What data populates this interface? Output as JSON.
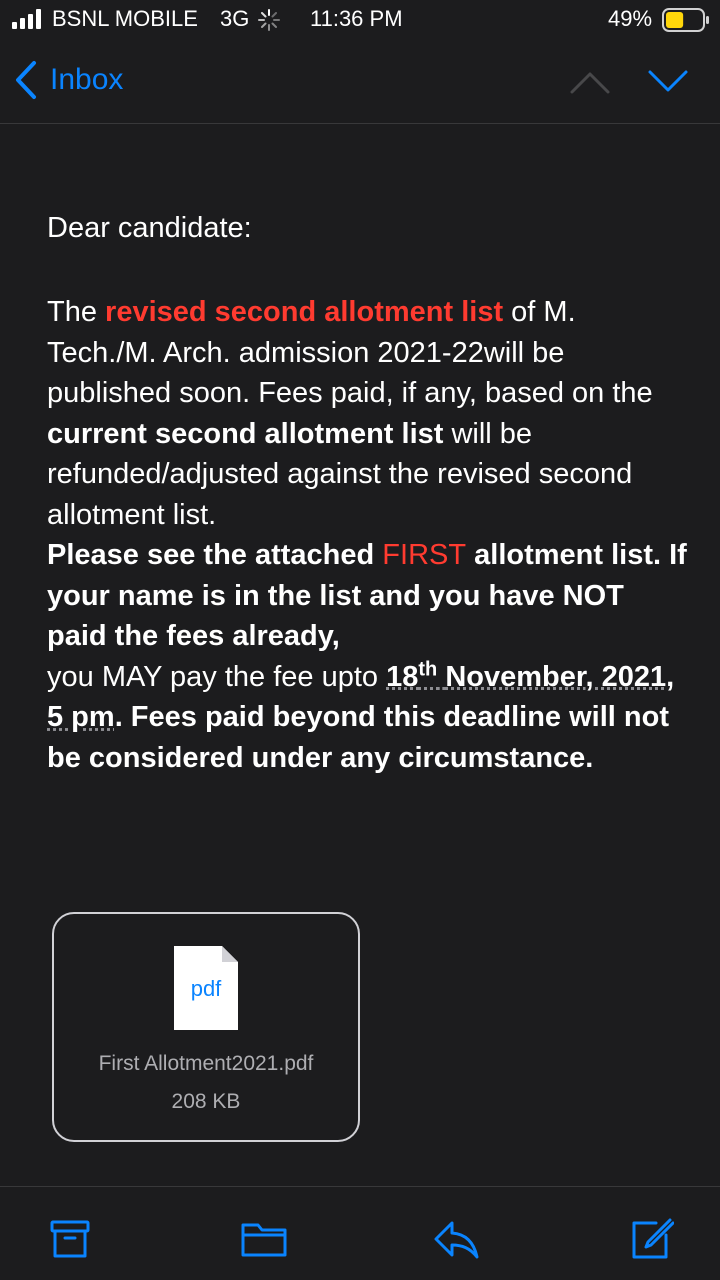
{
  "status_bar": {
    "carrier": "BSNL MOBILE",
    "network": "3G",
    "time": "11:36 PM",
    "battery_percent": "49%",
    "battery_level": 0.49,
    "signal_icon": "signal-bars-icon",
    "battery_color": "#ffd60a"
  },
  "nav": {
    "back_label": "Inbox",
    "back_icon": "chevron-left-icon",
    "prev_icon": "chevron-up-icon",
    "next_icon": "chevron-down-icon",
    "accent": "#0a84ff"
  },
  "message": {
    "greeting": "Dear candidate:",
    "p1": {
      "t1": "The ",
      "t2": "revised second allotment list",
      "t3": " of M. Tech./M. Arch. admission 2021-22will be published soon.  Fees paid, if any, based on the ",
      "t4": "current second allotment list",
      "t5": " will be refunded/adjusted against the revised second allotment list."
    },
    "p2": {
      "t1": "Please see the attached ",
      "t2": "FIRST",
      "t3": " allotment list. If your name is in the list and you have NOT paid the fees already,",
      "t4": "you MAY pay the fee  upto ",
      "t5": "18",
      "t6": "th",
      "t7": "November, 2021, 5 pm",
      "t8": ". Fees paid beyond this deadline will not be considered under any circumstance."
    },
    "highlight_color": "#ff3b30"
  },
  "attachment": {
    "icon_label": "pdf",
    "file_name": "First Allotment2021.pdf",
    "file_size": "208 KB"
  },
  "toolbar": {
    "icons": [
      "archive-icon",
      "folder-icon",
      "reply-icon",
      "compose-icon"
    ]
  }
}
